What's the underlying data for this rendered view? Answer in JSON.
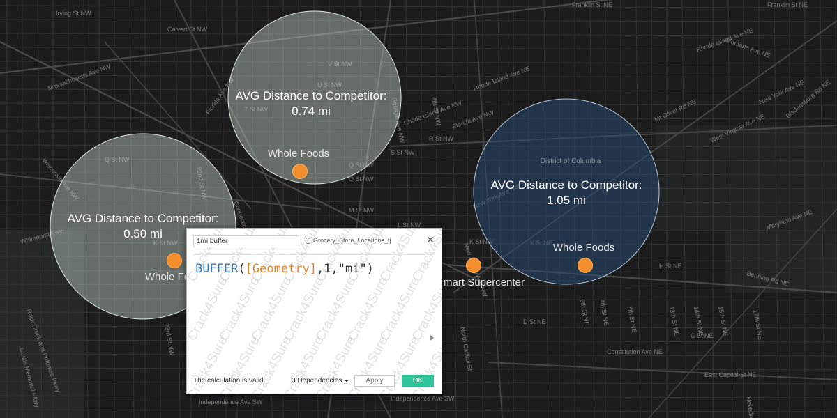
{
  "map": {
    "street_labels": [
      "Calvert St NW",
      "Franklin St NE",
      "Franklin St NE",
      "Irving St NW",
      "Rhode Island Ave NE",
      "Montana Ave NE",
      "Rhode Island Ave NE",
      "Massachusetts Ave NW",
      "T St NW",
      "V St NW",
      "U St NW",
      "Florida Ave NW",
      "Florida Ave NW",
      "R St NW",
      "S St NW",
      "Q St NW",
      "Q St NW",
      "Wisconsin Ave NW",
      "New York Ave NE",
      "Rhode Island Ave NW",
      "Bladensburg Rd NE",
      "West Virginia Ave NE",
      "Mt Olivet Rd NE",
      "M St NW",
      "L St NW",
      "O St NW",
      "New York Ave NW",
      "Whitehurst Fwy",
      "K St NW",
      "K St NW",
      "K St NE",
      "Maryland Ave NE",
      "Benning Rd NE",
      "H St NE",
      "D St NE",
      "C St NE",
      "Constitution Ave NE",
      "East Capitol St NE",
      "Independence Ave SW",
      "Independence Ave SW",
      "Rock Creek and Potomac Pkwy",
      "Connecticut Ave NW",
      "Georgia Ave NW",
      "4th St NW",
      "4th St NE",
      "6th St NE",
      "8th St NE",
      "13th St NE",
      "14th St NE",
      "15th St NE",
      "17th St NE",
      "22nd St NW",
      "23rd St NW",
      "Custis Memorial Pkwy",
      "North Capitol St",
      "New Jersey Ave NW",
      "Nevada St NE"
    ],
    "district_label": "District of Columbia"
  },
  "buffers": [
    {
      "avg_title": "AVG Distance to Competitor:",
      "avg_value": "0.74 mi",
      "store_name": "Whole Foods"
    },
    {
      "avg_title": "AVG Distance to Competitor:",
      "avg_value": "0.50 mi",
      "store_name": "Whole Fo"
    },
    {
      "avg_title": "AVG Distance to Competitor:",
      "avg_value": "1.05 mi",
      "store_name": "Whole Foods"
    }
  ],
  "other_store_label": "mart Supercenter",
  "dialog": {
    "calc_name": "1mi buffer",
    "data_source": "Grocery_Store_Locations_tj",
    "formula": {
      "fn": "BUFFER",
      "open": "(",
      "field": "[Geometry]",
      "args": ",1,\"mi\")"
    },
    "status": "The calculation is valid.",
    "dependencies": "3 Dependencies",
    "apply_label": "Apply",
    "ok_label": "OK",
    "close_icon": "✕",
    "watermark": "Crack4Sure"
  },
  "colors": {
    "buffer_light": "#c7d3cc",
    "buffer_dark": "#2c4a6e",
    "store_dot": "#f28e2b",
    "ok_button": "#2fc49a"
  }
}
